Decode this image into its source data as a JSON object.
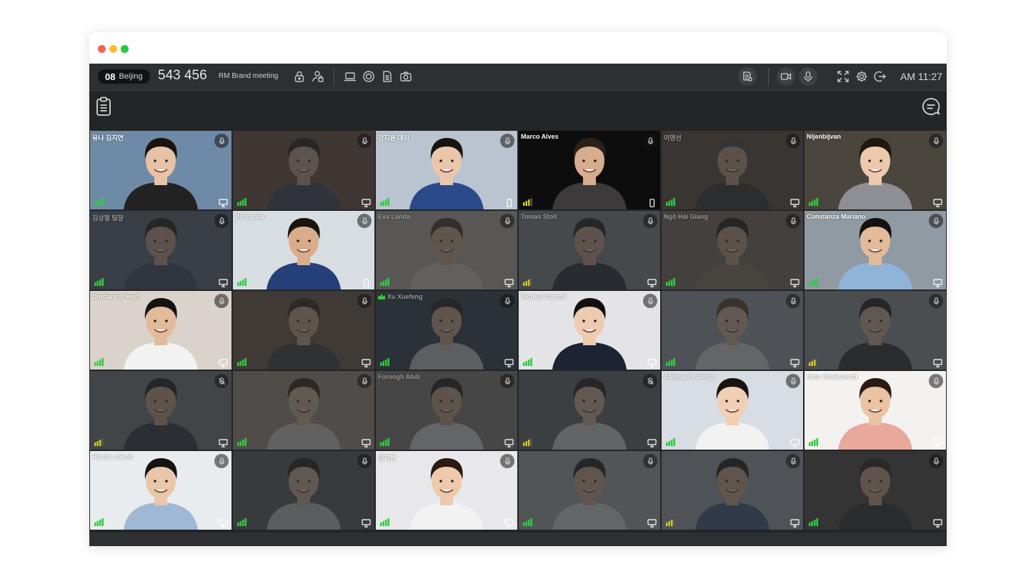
{
  "window": {
    "controls": [
      "close",
      "minimize",
      "maximize"
    ]
  },
  "topbar": {
    "room_number": "08",
    "room_city": "Beijing",
    "meeting_id": "543 456",
    "meeting_name": "RM Brand meeting",
    "clock": "AM 11:27",
    "icons_left": [
      "lock-icon",
      "user-lock-icon",
      "laptop-icon",
      "record-icon",
      "document-icon",
      "camera-icon"
    ],
    "icons_right": [
      "report-icon",
      "video-icon",
      "microphone-icon",
      "fullscreen-icon",
      "gear-icon",
      "exit-icon"
    ]
  },
  "toolbar": {
    "left_icon": "clipboard-icon",
    "right_icon": "chat-icon"
  },
  "tiles": [
    {
      "name": "유나 김지연",
      "active": true,
      "mic": "on",
      "device": "desktop",
      "signal": 4,
      "bg": "#6f8aa6",
      "skin": "#e8c2a4",
      "hair": "#1a1410",
      "shirt": "#222222"
    },
    {
      "name": "",
      "active": false,
      "mic": "on",
      "device": "desktop",
      "signal": 4,
      "bg": "#6b5040",
      "skin": "#d9b296",
      "hair": "#1c1612",
      "shirt": "#3a4658"
    },
    {
      "name": "강지원 대리",
      "active": true,
      "mic": "on",
      "device": "phone",
      "signal": 4,
      "bg": "#b9c4d0",
      "skin": "#eac7ab",
      "hair": "#171310",
      "shirt": "#2b4a8a"
    },
    {
      "name": "Marco Alves",
      "active": true,
      "mic": "on",
      "device": "phone",
      "signal": 3,
      "bg": "#0d0d0d",
      "skin": "#d6ad8e",
      "hair": "#2b2119",
      "shirt": "#3c3a3a"
    },
    {
      "name": "이영선",
      "active": false,
      "mic": "on",
      "device": "desktop",
      "signal": 4,
      "bg": "#5a4a3c",
      "skin": "#d4ab8c",
      "hair": "#4a4a4a",
      "shirt": "#2e2e2e"
    },
    {
      "name": "Nijenbijvan",
      "active": true,
      "mic": "on",
      "device": "desktop",
      "signal": 4,
      "bg": "#4a463e",
      "skin": "#ecc9ad",
      "hair": "#201810",
      "shirt": "#8d8f95"
    },
    {
      "name": "김상철 팀장",
      "active": false,
      "mic": "on",
      "device": "desktop",
      "signal": 4,
      "bg": "#5f6e80",
      "skin": "#d6b092",
      "hair": "#161210",
      "shirt": "#3a4a66"
    },
    {
      "name": "Bo Landa",
      "active": true,
      "mic": "on",
      "device": "phone",
      "signal": 4,
      "bg": "#d8dde2",
      "skin": "#d9ad8a",
      "hair": "#1a1410",
      "shirt": "#253f78"
    },
    {
      "name": "Eva Landa",
      "active": false,
      "mic": "on",
      "device": "desktop",
      "signal": 4,
      "bg": "#c9c2ba",
      "skin": "#e2b995",
      "hair": "#4a2e1c",
      "shirt": "#e8e3dc"
    },
    {
      "name": "Tomas Stoll",
      "active": false,
      "mic": "on",
      "device": "desktop",
      "signal": 3,
      "bg": "#8a8f96",
      "skin": "#dcb596",
      "hair": "#161210",
      "shirt": "#1e2533"
    },
    {
      "name": "Ngô Hải Giang",
      "active": false,
      "mic": "on",
      "device": "desktop",
      "signal": 4,
      "bg": "#7e6f64",
      "skin": "#d6ad8c",
      "hair": "#181310",
      "shirt": "#8c7a68"
    },
    {
      "name": "Constanza Mariano",
      "active": true,
      "mic": "on",
      "device": "desktop",
      "signal": 4,
      "bg": "#8f9aa3",
      "skin": "#e2bb9b",
      "hair": "#141110",
      "shirt": "#8fb4d8"
    },
    {
      "name": "Dardanion Hart",
      "active": true,
      "mic": "on",
      "device": "desktop",
      "signal": 4,
      "bg": "#d9d3cb",
      "skin": "#e2bb9b",
      "hair": "#141110",
      "shirt": "#f2f2f2"
    },
    {
      "name": "",
      "active": false,
      "mic": "on",
      "device": "desktop",
      "signal": 4,
      "bg": "#6f5a48",
      "skin": "#dfb796",
      "hair": "#2d2116",
      "shirt": "#3a3a3a"
    },
    {
      "name": "Xu Xuefeng",
      "active": false,
      "crown": true,
      "mic": "on",
      "device": "desktop",
      "signal": 4,
      "bg": "#2a3a4a",
      "skin": "#e2bc9c",
      "hair": "#1b1612",
      "shirt": "#d9dbe0"
    },
    {
      "name": "Tionley Carroll",
      "active": true,
      "mic": "on",
      "device": "desktop",
      "signal": 4,
      "bg": "#e4e4e6",
      "skin": "#eccbb0",
      "hair": "#121010",
      "shirt": "#1c2433"
    },
    {
      "name": "",
      "active": false,
      "mic": "on",
      "device": "desktop",
      "signal": 4,
      "bg": "#a4b0ba",
      "skin": "#ecc9ad",
      "hair": "#5a3a24",
      "shirt": "#f2f2f2"
    },
    {
      "name": "",
      "active": false,
      "mic": "on",
      "device": "desktop",
      "signal": 3,
      "bg": "#9aa0a6",
      "skin": "#e6c2a6",
      "hair": "#161210",
      "shirt": "#2a2a2a"
    },
    {
      "name": "",
      "active": false,
      "mic": "muted",
      "device": "desktop",
      "signal": 3,
      "bg": "#7a8088",
      "skin": "#dcb292",
      "hair": "#161210",
      "shirt": "#2a2f3a"
    },
    {
      "name": "",
      "active": false,
      "mic": "on",
      "device": "desktop",
      "signal": 4,
      "bg": "#a99a8c",
      "skin": "#ecc8aa",
      "hair": "#2a1c12",
      "shirt": "#e8e6e2"
    },
    {
      "name": "Foroogh Abdi",
      "active": false,
      "mic": "on",
      "device": "desktop",
      "signal": 4,
      "bg": "#8c8680",
      "skin": "#dcb292",
      "hair": "#161210",
      "shirt": "#f2f2f2"
    },
    {
      "name": "",
      "active": false,
      "mic": "muted",
      "device": "desktop",
      "signal": 3,
      "bg": "#6a6a70",
      "skin": "#ecc8aa",
      "hair": "#1e1410",
      "shirt": "#f0f0f0"
    },
    {
      "name": "Abimael Malinga",
      "active": true,
      "mic": "on",
      "device": "desktop",
      "signal": 4,
      "bg": "#d7dde3",
      "skin": "#f0cfb4",
      "hair": "#1a1410",
      "shirt": "#f2f2f2"
    },
    {
      "name": "Indu Chakravarti",
      "active": true,
      "mic": "on",
      "device": "desktop",
      "signal": 4,
      "bg": "#f4f2f0",
      "skin": "#eac3a3",
      "hair": "#2a1a12",
      "shirt": "#e8a89c"
    },
    {
      "name": "Hartna Jakob",
      "active": true,
      "mic": "on",
      "device": "desktop",
      "signal": 4,
      "bg": "#e9ecef",
      "skin": "#eac7aa",
      "hair": "#161210",
      "shirt": "#9fb8d6"
    },
    {
      "name": "",
      "active": false,
      "mic": "on",
      "device": "desktop",
      "signal": 4,
      "bg": "#5a5a5e",
      "skin": "#e6c2a6",
      "hair": "#161210",
      "shirt": "#d8d8d8"
    },
    {
      "name": "김지현",
      "active": true,
      "mic": "on",
      "device": "desktop",
      "signal": 4,
      "bg": "#e8e8ea",
      "skin": "#eec9ab",
      "hair": "#2a1a12",
      "shirt": "#f2f2f2"
    },
    {
      "name": "",
      "active": false,
      "mic": "on",
      "device": "desktop",
      "signal": 4,
      "bg": "#b6b8ba",
      "skin": "#e2bb9b",
      "hair": "#161210",
      "shirt": "#f2f2f2"
    },
    {
      "name": "",
      "active": false,
      "mic": "on",
      "device": "desktop",
      "signal": 3,
      "bg": "#a8b4be",
      "skin": "#e2bb9b",
      "hair": "#141110",
      "shirt": "#3a5a88"
    },
    {
      "name": "",
      "active": false,
      "mic": "on",
      "device": "desktop",
      "signal": 4,
      "bg": "#4a4440",
      "skin": "#dfb796",
      "hair": "#2a1a12",
      "shirt": "#2a2a2a"
    }
  ],
  "colors": {
    "signal_green": "#2ecc40",
    "signal_yellow": "#d4c520",
    "accent_text": "#ffffff"
  }
}
